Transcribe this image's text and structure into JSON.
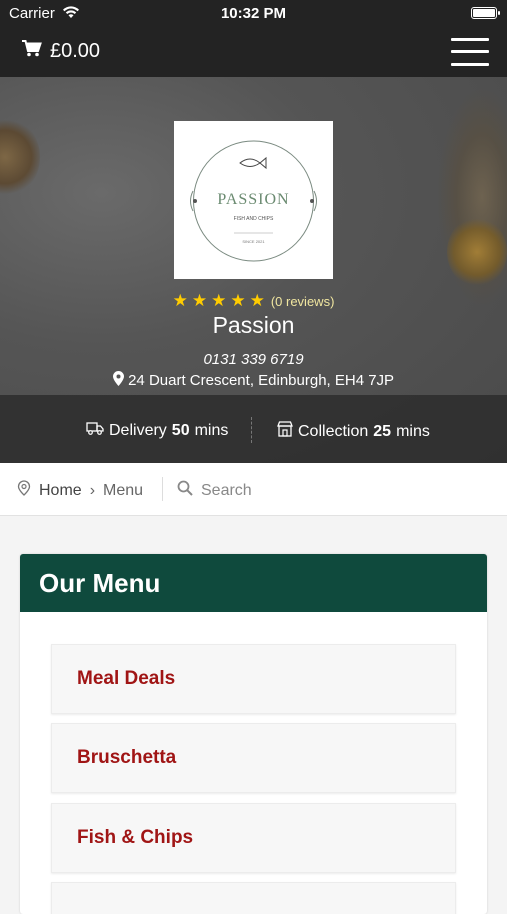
{
  "status_bar": {
    "carrier": "Carrier",
    "time": "10:32 PM"
  },
  "header": {
    "cart_total": "£0.00",
    "icons": [
      "cart-icon",
      "hamburger-menu-icon"
    ]
  },
  "shop": {
    "logo": {
      "name": "PASSION",
      "tagline": "FISH AND CHIPS",
      "since": "SINCE 2021"
    },
    "rating_stars": 5,
    "reviews": "(0 reviews)",
    "name": "Passion",
    "phone": "0131 339 6719",
    "address": "24 Duart Crescent, Edinburgh, EH4 7JP",
    "delivery": {
      "label": "Delivery",
      "value": "50",
      "unit": "mins"
    },
    "collection": {
      "label": "Collection",
      "value": "25",
      "unit": "mins"
    }
  },
  "breadcrumb": {
    "home": "Home",
    "separator": "›",
    "current": "Menu"
  },
  "search": {
    "placeholder": "Search"
  },
  "menu": {
    "title": "Our Menu",
    "items": [
      {
        "label": "Meal Deals"
      },
      {
        "label": "Bruschetta"
      },
      {
        "label": "Fish & Chips"
      }
    ]
  },
  "colors": {
    "header_bg": "#232323",
    "menu_header": "#0f4a3d",
    "item_text": "#a01515",
    "star": "#ffcc00"
  }
}
